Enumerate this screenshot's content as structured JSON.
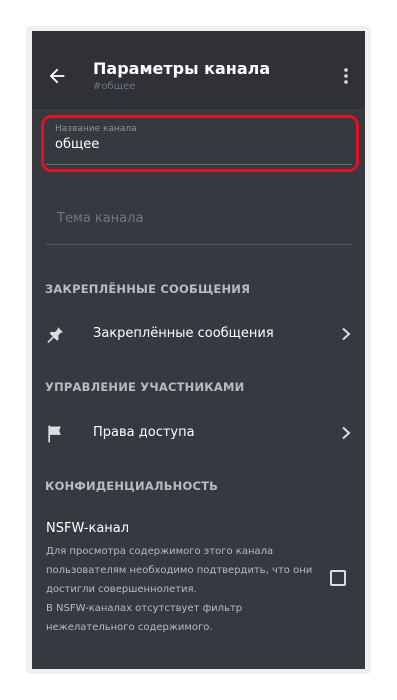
{
  "header": {
    "title": "Параметры канала",
    "subtitle": "#общее",
    "back_icon": "arrow-left-icon",
    "more_icon": "more-vertical-icon"
  },
  "fields": {
    "channel_name": {
      "label": "Название канала",
      "value": "общее"
    },
    "channel_topic": {
      "placeholder": "Тема канала"
    }
  },
  "sections": {
    "pinned": {
      "header": "ЗАКРЕПЛЁННЫЕ СООБЩЕНИЯ",
      "item_label": "Закреплённые сообщения",
      "icon": "pin-icon"
    },
    "members": {
      "header": "УПРАВЛЕНИЕ УЧАСТНИКАМИ",
      "item_label": "Права доступа",
      "icon": "flag-icon"
    },
    "privacy": {
      "header": "КОНФИДЕНЦИАЛЬНОСТЬ",
      "nsfw_title": "NSFW-канал",
      "nsfw_description": [
        "Для просмотра содержимого этого канала",
        "пользователям необходимо подтвердить, что они",
        "достигли совершеннолетия.",
        "В NSFW-каналах отсутствует фильтр",
        "нежелательного содержимого."
      ],
      "nsfw_checked": false
    }
  },
  "colors": {
    "background": "#36393f",
    "header_bg": "#2f3136",
    "highlight": "#e60f23"
  }
}
